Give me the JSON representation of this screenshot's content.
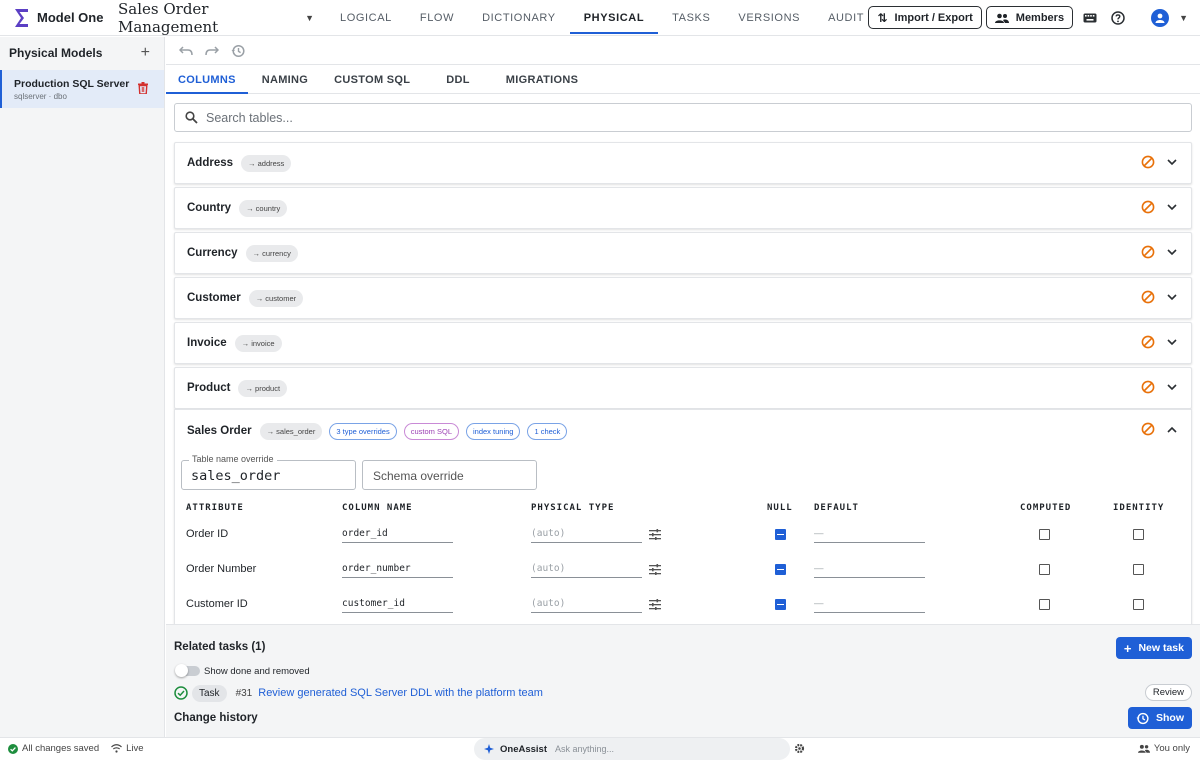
{
  "app": {
    "name": "Model One",
    "project_title": "Sales Order Management"
  },
  "nav": {
    "tabs": [
      "LOGICAL",
      "FLOW",
      "DICTIONARY",
      "PHYSICAL",
      "TASKS",
      "VERSIONS",
      "AUDIT LOG"
    ],
    "active": "PHYSICAL"
  },
  "header": {
    "import_export_label": "Import / Export",
    "members_label": "Members"
  },
  "sidebar": {
    "title": "Physical Models",
    "models": [
      {
        "name": "Production SQL Server",
        "sub": "sqlserver · dbo"
      }
    ]
  },
  "subtabs": {
    "items": [
      "COLUMNS",
      "NAMING",
      "CUSTOM SQL",
      "DDL",
      "MIGRATIONS"
    ],
    "active": "COLUMNS"
  },
  "search": {
    "placeholder": "Search tables..."
  },
  "tables": [
    {
      "name": "Address",
      "physical": "→ address"
    },
    {
      "name": "Country",
      "physical": "→ country"
    },
    {
      "name": "Currency",
      "physical": "→ currency"
    },
    {
      "name": "Customer",
      "physical": "→ customer"
    },
    {
      "name": "Invoice",
      "physical": "→ invoice"
    },
    {
      "name": "Product",
      "physical": "→ product"
    }
  ],
  "expanded_table": {
    "name": "Sales Order",
    "physical": "→ sales_order",
    "tags": [
      {
        "label": "3 type overrides",
        "tone": "blue"
      },
      {
        "label": "custom SQL",
        "tone": "purple"
      },
      {
        "label": "index tuning",
        "tone": "blue"
      },
      {
        "label": "1 check",
        "tone": "blue"
      }
    ],
    "table_name_label": "Table name override",
    "table_name_value": "sales_order",
    "schema_placeholder": "Schema override",
    "headers": {
      "attribute": "ATTRIBUTE",
      "column_name": "COLUMN NAME",
      "physical_type": "PHYSICAL TYPE",
      "null": "NULL",
      "default": "DEFAULT",
      "computed": "COMPUTED",
      "identity": "IDENTITY"
    },
    "rows": [
      {
        "attribute": "Order ID",
        "column": "order_id",
        "type": "(auto)",
        "null": true,
        "default": "—",
        "computed": false,
        "identity": false
      },
      {
        "attribute": "Order Number",
        "column": "order_number",
        "type": "(auto)",
        "null": true,
        "default": "—",
        "computed": false,
        "identity": false
      },
      {
        "attribute": "Customer ID",
        "column": "customer_id",
        "type": "(auto)",
        "null": true,
        "default": "—",
        "computed": false,
        "identity": false
      }
    ]
  },
  "related_tasks": {
    "title": "Related tasks (1)",
    "new_task_label": "New task",
    "toggle_label": "Show done and removed",
    "tasks": [
      {
        "chip": "Task",
        "number": "#31",
        "title": "Review generated SQL Server DDL with the platform team",
        "action": "Review"
      }
    ]
  },
  "change_history": {
    "title": "Change history",
    "show_label": "Show"
  },
  "status": {
    "saved": "All changes saved",
    "live": "Live",
    "assist_name": "OneAssist",
    "assist_placeholder": "Ask anything...",
    "visibility": "You only"
  },
  "colors": {
    "accent": "#1f5fd6",
    "warning": "#e8710a",
    "purple": "#9b3fb3"
  }
}
